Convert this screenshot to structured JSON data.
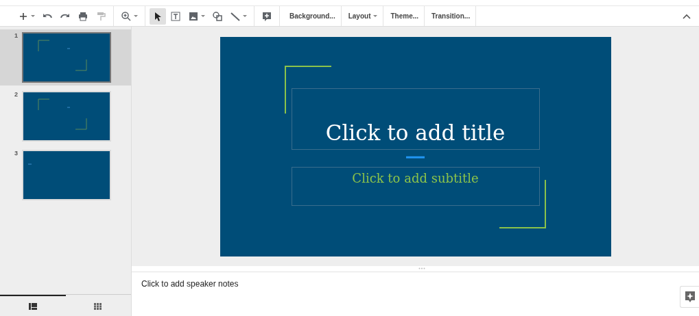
{
  "toolbar": {
    "tools": [
      {
        "kind": "new",
        "selected": false
      },
      {
        "kind": "undo",
        "selected": false
      },
      {
        "kind": "redo",
        "selected": false
      },
      {
        "kind": "print",
        "selected": false
      },
      {
        "kind": "paint",
        "selected": false
      },
      {
        "kind": "zoom",
        "selected": false
      },
      {
        "kind": "select",
        "selected": true
      },
      {
        "kind": "textbox",
        "selected": false
      },
      {
        "kind": "image",
        "selected": false
      },
      {
        "kind": "shape",
        "selected": false
      },
      {
        "kind": "line",
        "selected": false
      },
      {
        "kind": "comment",
        "selected": false
      }
    ],
    "menus": [
      {
        "label": "Background...",
        "dropdown": false
      },
      {
        "label": "Layout",
        "dropdown": true
      },
      {
        "label": "Theme...",
        "dropdown": false
      },
      {
        "label": "Transition...",
        "dropdown": false
      }
    ]
  },
  "filmstrip": {
    "slides": [
      {
        "number": "1",
        "kind": "title",
        "selected": true
      },
      {
        "number": "2",
        "kind": "title",
        "selected": false
      },
      {
        "number": "3",
        "kind": "blank",
        "selected": false
      }
    ],
    "views": [
      {
        "kind": "filmstrip",
        "selected": true
      },
      {
        "kind": "grid",
        "selected": false
      }
    ]
  },
  "slide": {
    "title_placeholder": "Click to add title",
    "subtitle_placeholder": "Click to add subtitle"
  },
  "notes": {
    "placeholder": "Click to add speaker notes"
  }
}
